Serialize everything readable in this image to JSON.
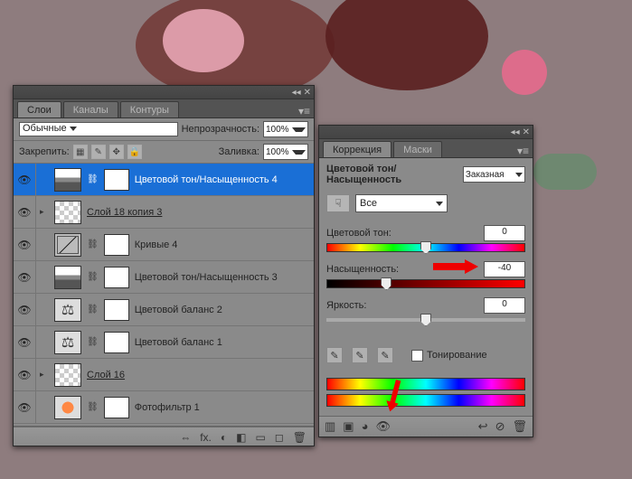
{
  "bg_colors": {
    "blob1": "#c57d97",
    "blob2": "#e8a5b4",
    "blob3": "#6a8a6f",
    "blob4": "#e66a8d",
    "blob5": "#7f2e2e"
  },
  "layers_panel": {
    "tabs": [
      "Слои",
      "Каналы",
      "Контуры"
    ],
    "blend_mode": "Обычные",
    "opacity_label": "Непрозрачность:",
    "opacity_value": "100%",
    "lock_label": "Закрепить:",
    "fill_label": "Заливка:",
    "fill_value": "100%",
    "layers": [
      {
        "name": "Цветовой тон/Насыщенность 4",
        "selected": true,
        "kind": "adj-hue",
        "mask": true,
        "nested": true,
        "underlined": false
      },
      {
        "name": "Слой 18 копия 3",
        "selected": false,
        "kind": "checker",
        "mask": false,
        "nested": false,
        "underlined": true
      },
      {
        "name": "Кривые 4",
        "selected": false,
        "kind": "adj-curves",
        "mask": true,
        "nested": true,
        "underlined": false
      },
      {
        "name": "Цветовой тон/Насыщенность 3",
        "selected": false,
        "kind": "adj-hue",
        "mask": true,
        "nested": true,
        "underlined": false
      },
      {
        "name": "Цветовой баланс 2",
        "selected": false,
        "kind": "adj-balance",
        "mask": true,
        "nested": true,
        "underlined": false
      },
      {
        "name": "Цветовой баланс 1",
        "selected": false,
        "kind": "adj-balance",
        "mask": true,
        "nested": true,
        "underlined": false
      },
      {
        "name": "Слой 16",
        "selected": false,
        "kind": "checker",
        "mask": false,
        "nested": false,
        "underlined": true
      },
      {
        "name": "Фотофильтр 1",
        "selected": false,
        "kind": "adj-photo",
        "mask": true,
        "nested": true,
        "underlined": false
      }
    ],
    "footer_icons": [
      "⇔",
      "fx.",
      "◐",
      "◧",
      "▭",
      "◻",
      "🗑"
    ]
  },
  "corr_panel": {
    "tabs": [
      "Коррекция",
      "Маски"
    ],
    "title": "Цветовой тон/Насыщенность",
    "preset": "Заказная",
    "range_label": "Все",
    "sliders": {
      "hue": {
        "label": "Цветовой тон:",
        "value": "0",
        "pct": 50
      },
      "saturation": {
        "label": "Насыщенность:",
        "value": "-40",
        "pct": 30
      },
      "brightness": {
        "label": "Яркость:",
        "value": "0",
        "pct": 50
      }
    },
    "colorize_label": "Тонирование",
    "footer_left": [
      "▥",
      "▣",
      "◕",
      "👁"
    ],
    "footer_right": [
      "↩",
      "⊘",
      "🗑"
    ]
  }
}
